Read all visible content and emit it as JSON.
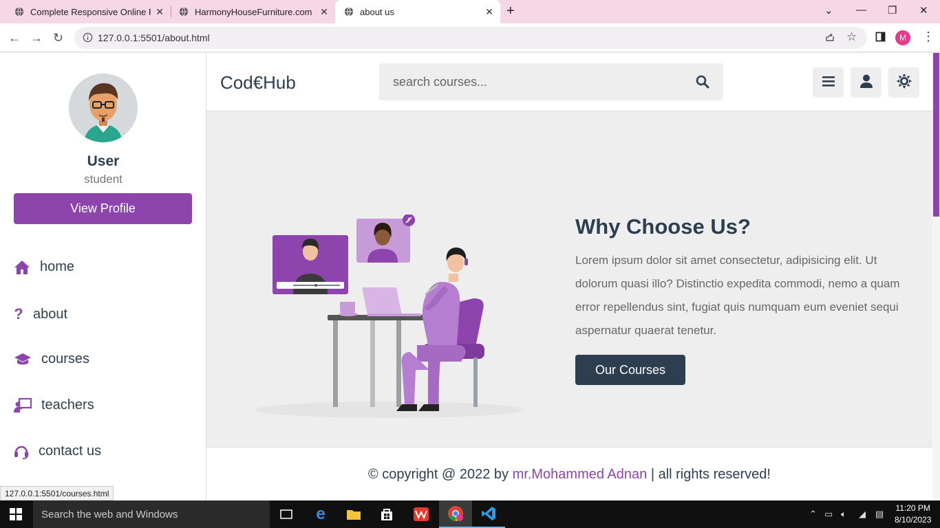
{
  "browser": {
    "tabs": [
      {
        "title": "Complete Responsive Online Perf"
      },
      {
        "title": "HarmonyHouseFurniture.com"
      },
      {
        "title": "about us"
      }
    ],
    "url": "127.0.0.1:5501/about.html",
    "profile_initial": "M",
    "status_url": "127.0.0.1:5501/courses.html"
  },
  "sidebar": {
    "user_name": "User",
    "user_role": "student",
    "view_profile_label": "View Profile",
    "nav": [
      {
        "label": "home",
        "icon": "home-icon"
      },
      {
        "label": "about",
        "icon": "question-icon"
      },
      {
        "label": "courses",
        "icon": "graduation-cap-icon"
      },
      {
        "label": "teachers",
        "icon": "chalkboard-teacher-icon"
      },
      {
        "label": "contact us",
        "icon": "headset-icon"
      }
    ]
  },
  "header": {
    "logo": "Cod€Hub",
    "search_placeholder": "search courses..."
  },
  "about": {
    "heading": "Why Choose Us?",
    "text": "Lorem ipsum dolor sit amet consectetur, adipisicing elit. Ut dolorum quasi illo? Distinctio expedita commodi, nemo a quam error repellendus sint, fugiat quis numquam eum eveniet sequi aspernatur quaerat tenetur.",
    "button": "Our Courses"
  },
  "footer": {
    "prefix": "© copyright @ 2022 by ",
    "author": "mr.Mohammed Adnan",
    "suffix": " | all rights reserved!"
  },
  "taskbar": {
    "search_placeholder": "Search the web and Windows",
    "time": "11:20 PM",
    "date": "8/10/2023"
  },
  "colors": {
    "accent": "#8e44ad",
    "dark": "#2c3e50",
    "tabbar": "#f7d6e6"
  }
}
